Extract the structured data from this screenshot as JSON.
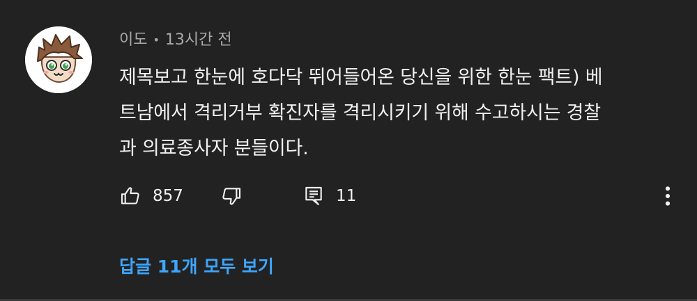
{
  "comment": {
    "author": "이도",
    "separator": "•",
    "time": "13시간 전",
    "text": "제목보고 한눈에 호다닥 뛰어들어온 당신을 위한 한눈 팩트) 베\n트남에서 격리거부 확진자를 격리시키기 위해 수고하시는 경찰\n과 의료종사자 분들이다.",
    "likes": "857",
    "replies_count": "11",
    "view_replies_label": "답글 11개 모두 보기"
  },
  "icons": {
    "avatar": "cartoon-avatar",
    "like": "thumbs-up-icon",
    "dislike": "thumbs-down-icon",
    "reply": "comment-icon",
    "more": "more-vertical-icon"
  },
  "colors": {
    "background": "#222222",
    "text": "#f1f1f1",
    "meta": "#aaaaaa",
    "link": "#3ea6ff"
  }
}
